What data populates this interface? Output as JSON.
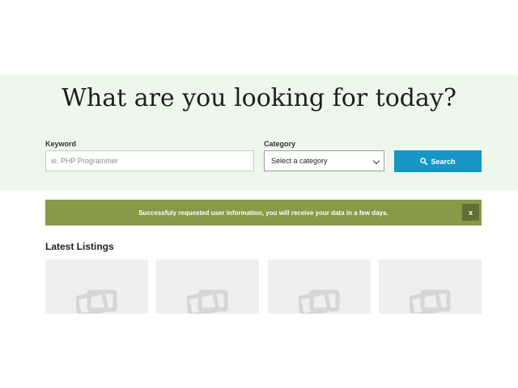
{
  "hero": {
    "title": "What are you looking for today?"
  },
  "search": {
    "keyword_label": "Keyword",
    "keyword_placeholder": "ie. PHP Programmer",
    "keyword_value": "",
    "category_label": "Category",
    "category_selected": "Select a category",
    "button_label": "Search",
    "button_icon": "search-icon",
    "button_color": "#1697c6"
  },
  "alert": {
    "message": "Successfuly requested user information, you will receive your data in a few days.",
    "close_label": "x",
    "background_color": "#869a48"
  },
  "listings": {
    "title": "Latest Listings",
    "items": [
      {
        "icon": "image-placeholder-icon"
      },
      {
        "icon": "image-placeholder-icon"
      },
      {
        "icon": "image-placeholder-icon"
      },
      {
        "icon": "image-placeholder-icon"
      }
    ]
  },
  "theme": {
    "hero_background": "#eef7ec",
    "listing_background": "#efefef"
  }
}
